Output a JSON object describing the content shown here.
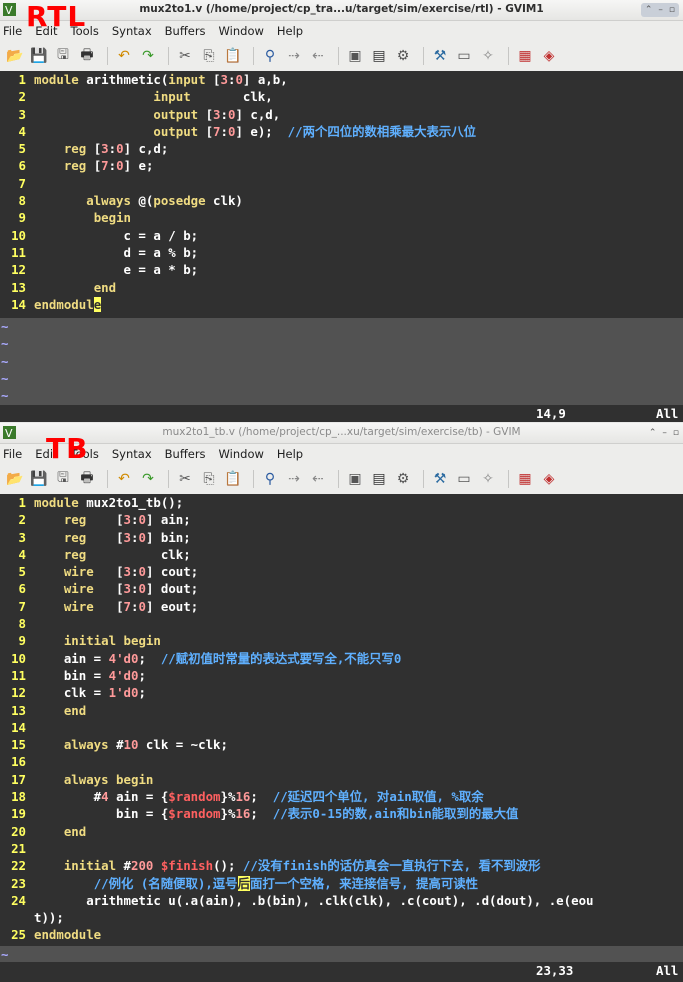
{
  "top": {
    "label": "RTL",
    "title": "mux2to1.v (/home/project/cp_tra...u/target/sim/exercise/rtl) - GVIM1",
    "menu": [
      "File",
      "Edit",
      "Tools",
      "Syntax",
      "Buffers",
      "Window",
      "Help"
    ],
    "code": [
      [
        [
          "module ",
          "kw"
        ],
        [
          "arithmetic(",
          ""
        ],
        [
          "input ",
          "kw"
        ],
        [
          "[",
          ""
        ],
        [
          "3",
          "num"
        ],
        [
          ":",
          ""
        ],
        [
          "0",
          "num"
        ],
        [
          "] a,b,",
          ""
        ]
      ],
      [
        [
          "                ",
          ""
        ],
        [
          "input",
          "kw"
        ],
        [
          "       clk,",
          ""
        ]
      ],
      [
        [
          "                ",
          ""
        ],
        [
          "output ",
          "kw"
        ],
        [
          "[",
          ""
        ],
        [
          "3",
          "num"
        ],
        [
          ":",
          ""
        ],
        [
          "0",
          "num"
        ],
        [
          "] c,d,",
          ""
        ]
      ],
      [
        [
          "                ",
          ""
        ],
        [
          "output ",
          "kw"
        ],
        [
          "[",
          ""
        ],
        [
          "7",
          "num"
        ],
        [
          ":",
          ""
        ],
        [
          "0",
          "num"
        ],
        [
          "] e);  ",
          ""
        ],
        [
          "//两个四位的数相乘最大表示八位",
          "cmt"
        ]
      ],
      [
        [
          "    ",
          ""
        ],
        [
          "reg ",
          "kw"
        ],
        [
          "[",
          ""
        ],
        [
          "3",
          "num"
        ],
        [
          ":",
          ""
        ],
        [
          "0",
          "num"
        ],
        [
          "] c,d;",
          ""
        ]
      ],
      [
        [
          "    ",
          ""
        ],
        [
          "reg ",
          "kw"
        ],
        [
          "[",
          ""
        ],
        [
          "7",
          "num"
        ],
        [
          ":",
          ""
        ],
        [
          "0",
          "num"
        ],
        [
          "] e;",
          ""
        ]
      ],
      [
        [
          "",
          ""
        ]
      ],
      [
        [
          "       ",
          ""
        ],
        [
          "always ",
          "kw"
        ],
        [
          "@(",
          ""
        ],
        [
          "posedge ",
          "kw"
        ],
        [
          "clk)",
          ""
        ]
      ],
      [
        [
          "        ",
          ""
        ],
        [
          "begin",
          "kw"
        ]
      ],
      [
        [
          "            c = a / b;",
          ""
        ]
      ],
      [
        [
          "            d = a % b;",
          ""
        ]
      ],
      [
        [
          "            e = a * b;",
          ""
        ]
      ],
      [
        [
          "        ",
          ""
        ],
        [
          "end",
          "kw"
        ]
      ],
      [
        [
          "endmodul",
          "kw"
        ],
        [
          "e",
          "cur"
        ]
      ]
    ],
    "tildes": [
      "~",
      "~",
      "~",
      "~",
      "~"
    ],
    "cursor_pos": "14,9",
    "scroll": "All"
  },
  "bottom": {
    "label": "TB",
    "title": "mux2to1_tb.v (/home/project/cp_...xu/target/sim/exercise/tb) - GVIM",
    "menu": [
      "File",
      "Edit",
      "Tools",
      "Syntax",
      "Buffers",
      "Window",
      "Help"
    ],
    "code": [
      [
        [
          "module ",
          "kw"
        ],
        [
          "mux2to1_tb();",
          ""
        ]
      ],
      [
        [
          "    ",
          ""
        ],
        [
          "reg    ",
          "kw"
        ],
        [
          "[",
          ""
        ],
        [
          "3",
          "num"
        ],
        [
          ":",
          ""
        ],
        [
          "0",
          "num"
        ],
        [
          "] ain;",
          ""
        ]
      ],
      [
        [
          "    ",
          ""
        ],
        [
          "reg    ",
          "kw"
        ],
        [
          "[",
          ""
        ],
        [
          "3",
          "num"
        ],
        [
          ":",
          ""
        ],
        [
          "0",
          "num"
        ],
        [
          "] bin;",
          ""
        ]
      ],
      [
        [
          "    ",
          ""
        ],
        [
          "reg",
          "kw"
        ],
        [
          "          clk;",
          ""
        ]
      ],
      [
        [
          "    ",
          ""
        ],
        [
          "wire   ",
          "kw"
        ],
        [
          "[",
          ""
        ],
        [
          "3",
          "num"
        ],
        [
          ":",
          ""
        ],
        [
          "0",
          "num"
        ],
        [
          "] cout;",
          ""
        ]
      ],
      [
        [
          "    ",
          ""
        ],
        [
          "wire   ",
          "kw"
        ],
        [
          "[",
          ""
        ],
        [
          "3",
          "num"
        ],
        [
          ":",
          ""
        ],
        [
          "0",
          "num"
        ],
        [
          "] dout;",
          ""
        ]
      ],
      [
        [
          "    ",
          ""
        ],
        [
          "wire   ",
          "kw"
        ],
        [
          "[",
          ""
        ],
        [
          "7",
          "num"
        ],
        [
          ":",
          ""
        ],
        [
          "0",
          "num"
        ],
        [
          "] eout;",
          ""
        ]
      ],
      [
        [
          "",
          ""
        ]
      ],
      [
        [
          "    ",
          ""
        ],
        [
          "initial begin",
          "kw"
        ]
      ],
      [
        [
          "    ain = ",
          ""
        ],
        [
          "4'd0",
          "num"
        ],
        [
          ";  ",
          ""
        ],
        [
          "//赋初值时常量的表达式要写全,不能只写0",
          "cmt"
        ]
      ],
      [
        [
          "    bin = ",
          ""
        ],
        [
          "4'd0",
          "num"
        ],
        [
          ";",
          ""
        ]
      ],
      [
        [
          "    clk = ",
          ""
        ],
        [
          "1'd0",
          "num"
        ],
        [
          ";",
          ""
        ]
      ],
      [
        [
          "    ",
          ""
        ],
        [
          "end",
          "kw"
        ]
      ],
      [
        [
          "",
          ""
        ]
      ],
      [
        [
          "    ",
          ""
        ],
        [
          "always ",
          "kw"
        ],
        [
          "#",
          ""
        ],
        [
          "10",
          "num"
        ],
        [
          " clk = ~clk;",
          ""
        ]
      ],
      [
        [
          "",
          ""
        ]
      ],
      [
        [
          "    ",
          ""
        ],
        [
          "always begin",
          "kw"
        ]
      ],
      [
        [
          "        #",
          ""
        ],
        [
          "4",
          "num"
        ],
        [
          " ain = {",
          ""
        ],
        [
          "$random",
          "sys"
        ],
        [
          "}%",
          ""
        ],
        [
          "16",
          "num"
        ],
        [
          ";  ",
          ""
        ],
        [
          "//延迟四个单位, 对ain取值, %取余",
          "cmt"
        ]
      ],
      [
        [
          "           bin = {",
          ""
        ],
        [
          "$random",
          "sys"
        ],
        [
          "}%",
          ""
        ],
        [
          "16",
          "num"
        ],
        [
          ";  ",
          ""
        ],
        [
          "//表示0-15的数,ain和bin能取到的最大值",
          "cmt"
        ]
      ],
      [
        [
          "    ",
          ""
        ],
        [
          "end",
          "kw"
        ]
      ],
      [
        [
          "",
          ""
        ]
      ],
      [
        [
          "    ",
          ""
        ],
        [
          "initial ",
          "kw"
        ],
        [
          "#",
          ""
        ],
        [
          "200 ",
          "num"
        ],
        [
          "$finish",
          "sys"
        ],
        [
          "(); ",
          ""
        ],
        [
          "//没有finish的话仿真会一直执行下去, 看不到波形",
          "cmt"
        ]
      ],
      [
        [
          "        ",
          ""
        ],
        [
          "//例化 (名随便取),逗号",
          "cmt"
        ],
        [
          "后",
          "cur"
        ],
        [
          "面打一个空格, 来连接信号, 提高可读性",
          "cmt"
        ]
      ],
      [
        [
          "       arithmetic u(.a(ain), .b(bin), .clk(clk), .c(cout), .d(dout), .e(eou",
          ""
        ]
      ],
      [
        [
          "t));",
          ""
        ]
      ],
      [
        [
          "endmodule",
          "kw"
        ]
      ]
    ],
    "line_numbers": [
      "1",
      "2",
      "3",
      "4",
      "5",
      "6",
      "7",
      "8",
      "9",
      "10",
      "11",
      "12",
      "13",
      "14",
      "15",
      "16",
      "17",
      "18",
      "19",
      "20",
      "21",
      "22",
      "23",
      "24",
      "",
      "25"
    ],
    "tildes": [
      "~"
    ],
    "cursor_pos": "23,33",
    "scroll": "All"
  }
}
